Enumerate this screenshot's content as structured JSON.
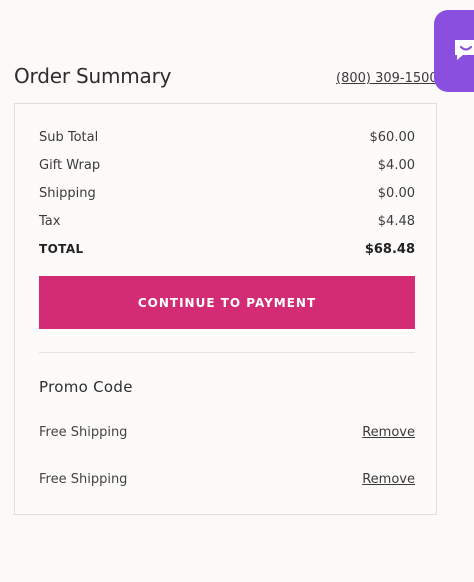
{
  "header": {
    "title": "Order Summary",
    "phone": "(800) 309-1500"
  },
  "summary": {
    "lines": [
      {
        "label": "Sub Total",
        "value": "$60.00"
      },
      {
        "label": "Gift Wrap",
        "value": "$4.00"
      },
      {
        "label": "Shipping",
        "value": "$0.00"
      },
      {
        "label": "Tax",
        "value": "$4.48"
      }
    ],
    "total": {
      "label": "TOTAL",
      "value": "$68.48"
    },
    "continue_label": "CONTINUE TO PAYMENT"
  },
  "promo": {
    "heading": "Promo Code",
    "codes": [
      {
        "name": "Free Shipping",
        "action": "Remove"
      },
      {
        "name": "Free Shipping",
        "action": "Remove"
      }
    ]
  },
  "colors": {
    "accent": "#d42c74",
    "chat_widget": "#8a4fde",
    "background": "#fcf9f8"
  },
  "icons": {
    "chat": "chat-bubble-icon"
  }
}
